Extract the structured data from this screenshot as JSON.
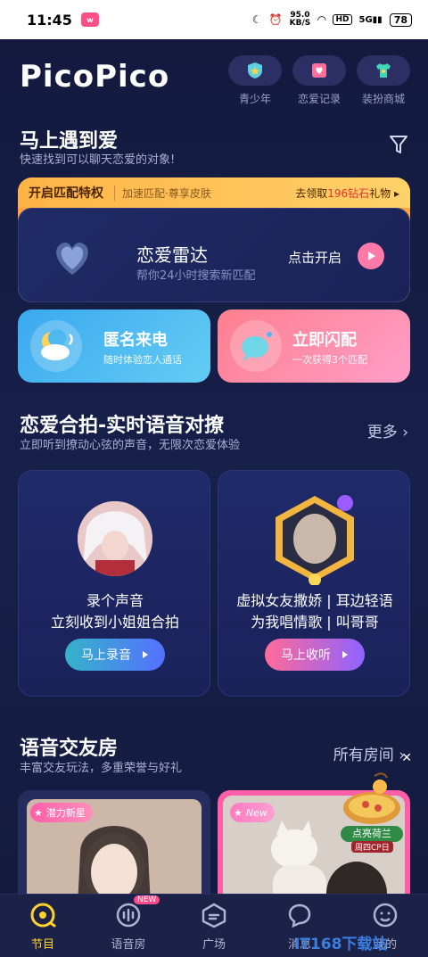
{
  "status_bar": {
    "time": "11:45",
    "net_speed": "95.0",
    "net_unit": "KB/S",
    "hd": "HD",
    "signal": "5G",
    "battery": "78"
  },
  "header": {
    "logo": "PicoPico",
    "icons": [
      {
        "label": "青少年",
        "icon": "shield-star-icon"
      },
      {
        "label": "恋爱记录",
        "icon": "heart-card-icon"
      },
      {
        "label": "装扮商城",
        "icon": "shirt-icon"
      }
    ]
  },
  "meet": {
    "title": "马上遇到爱",
    "subtitle": "快速找到可以聊天恋爱的对象!",
    "banner": {
      "label": "开启匹配特权",
      "perks": "加速匹配·尊享皮肤",
      "reward_prefix": "去领取",
      "reward_highlight": "196钻石",
      "reward_suffix": "礼物"
    },
    "radar": {
      "title": "恋爱雷达",
      "subtitle": "帮你24小时搜索新匹配",
      "cta": "点击开启"
    },
    "call": {
      "title": "匿名来电",
      "subtitle": "随时体验恋人通话"
    },
    "flash": {
      "title": "立即闪配",
      "subtitle": "一次获得3个匹配"
    }
  },
  "duet": {
    "title": "恋爱合拍-实时语音对撩",
    "subtitle": "立即听到撩动心弦的声音，无限次恋爱体验",
    "more": "更多",
    "cards": [
      {
        "line1": "录个声音",
        "line2": "立刻收到小姐姐合拍",
        "button": "马上录音"
      },
      {
        "line1": "虚拟女友撒娇 | 耳边轻语",
        "line2": "为我唱情歌 | 叫哥哥",
        "button": "马上收听"
      }
    ]
  },
  "rooms": {
    "title": "语音交友房",
    "subtitle": "丰富交友玩法，多重荣誉与好礼",
    "all": "所有房间",
    "tags": [
      "潜力新星",
      "New"
    ],
    "promo": {
      "label": "点亮荷兰",
      "sub": "周四CP日"
    }
  },
  "tabs": [
    {
      "label": "节目",
      "active": true
    },
    {
      "label": "语音房",
      "badge": "NEW"
    },
    {
      "label": "广场"
    },
    {
      "label": "消息"
    },
    {
      "label": "我的"
    }
  ],
  "watermark": "IT168下载站"
}
